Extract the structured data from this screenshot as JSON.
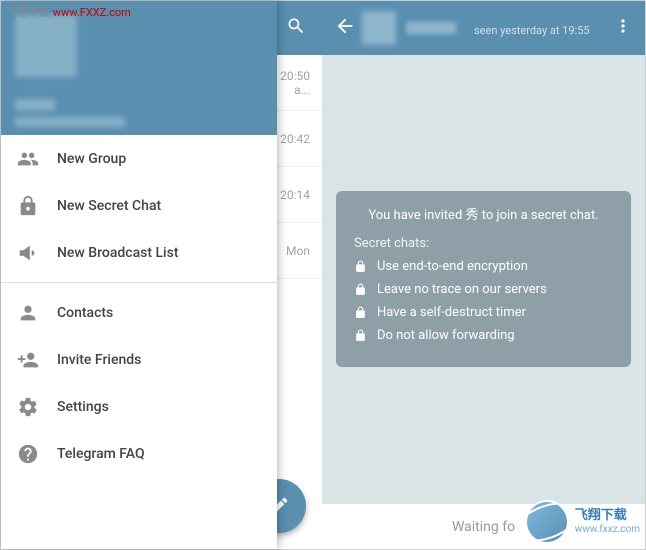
{
  "watermark": {
    "top_text": "飞翔下载",
    "top_url": "www.FXXZ.com",
    "bottom_cn": "飞翔下载",
    "bottom_en": "www.fxxz.com"
  },
  "chatlist": {
    "rows": [
      {
        "time": "20:50",
        "sub": "a..."
      },
      {
        "time": "20:42",
        "sub": ""
      },
      {
        "time": "20:14",
        "sub": ""
      },
      {
        "time": "Mon",
        "sub": ""
      }
    ]
  },
  "drawer": {
    "items_a": [
      {
        "key": "new-group",
        "label": "New Group"
      },
      {
        "key": "new-secret",
        "label": "New Secret Chat"
      },
      {
        "key": "new-broadcast",
        "label": "New Broadcast List"
      }
    ],
    "items_b": [
      {
        "key": "contacts",
        "label": "Contacts"
      },
      {
        "key": "invite",
        "label": "Invite Friends"
      },
      {
        "key": "settings",
        "label": "Settings"
      },
      {
        "key": "faq",
        "label": "Telegram FAQ"
      }
    ]
  },
  "chat": {
    "seen_text": "seen yesterday at 19:55",
    "invite_line": "You have invited 秀 to join a secret chat.",
    "info_title": "Secret chats:",
    "features": [
      "Use end-to-end encryption",
      "Leave no trace on our servers",
      "Have a self-destruct timer",
      "Do not allow forwarding"
    ],
    "input_placeholder": "Waiting fo"
  }
}
